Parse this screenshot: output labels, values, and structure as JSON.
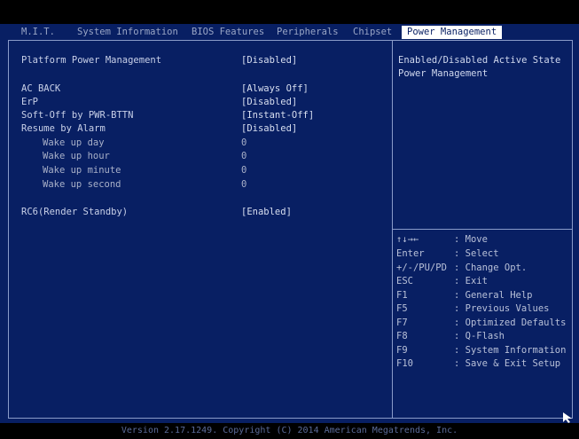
{
  "tabs": [
    {
      "label": "M.I.T.",
      "active": false
    },
    {
      "label": "System Information",
      "active": false
    },
    {
      "label": "BIOS Features",
      "active": false
    },
    {
      "label": "Peripherals",
      "active": false
    },
    {
      "label": "Chipset",
      "active": false
    },
    {
      "label": "Power Management",
      "active": true
    }
  ],
  "settings": [
    {
      "label": "Platform Power Management",
      "value": "[Disabled]"
    },
    {
      "label": "AC BACK",
      "value": "[Always Off]"
    },
    {
      "label": "ErP",
      "value": "[Disabled]"
    },
    {
      "label": "Soft-Off by PWR-BTTN",
      "value": "[Instant-Off]"
    },
    {
      "label": "Resume by Alarm",
      "value": "[Disabled]"
    },
    {
      "label": "Wake up day",
      "value": "0"
    },
    {
      "label": "Wake up hour",
      "value": "0"
    },
    {
      "label": "Wake up minute",
      "value": "0"
    },
    {
      "label": "Wake up second",
      "value": "0"
    },
    {
      "label": "RC6(Render Standby)",
      "value": "[Enabled]"
    }
  ],
  "help_text": "Enabled/Disabled Active State Power Management",
  "key_help": [
    {
      "key": "↑↓→←",
      "desc": ": Move"
    },
    {
      "key": "Enter",
      "desc": ": Select"
    },
    {
      "key": "+/-/PU/PD",
      "desc": ": Change Opt."
    },
    {
      "key": "ESC",
      "desc": ": Exit"
    },
    {
      "key": "F1",
      "desc": ": General Help"
    },
    {
      "key": "F5",
      "desc": ": Previous Values"
    },
    {
      "key": "F7",
      "desc": ": Optimized Defaults"
    },
    {
      "key": "F8",
      "desc": ": Q-Flash"
    },
    {
      "key": "F9",
      "desc": ": System Information"
    },
    {
      "key": "F10",
      "desc": ": Save & Exit Setup"
    }
  ],
  "footer": "Version 2.17.1249. Copyright (C) 2014 American Megatrends, Inc.",
  "colors": {
    "background": "#081f63",
    "active_tab": "#ffffff",
    "border": "#8a9bc9"
  }
}
